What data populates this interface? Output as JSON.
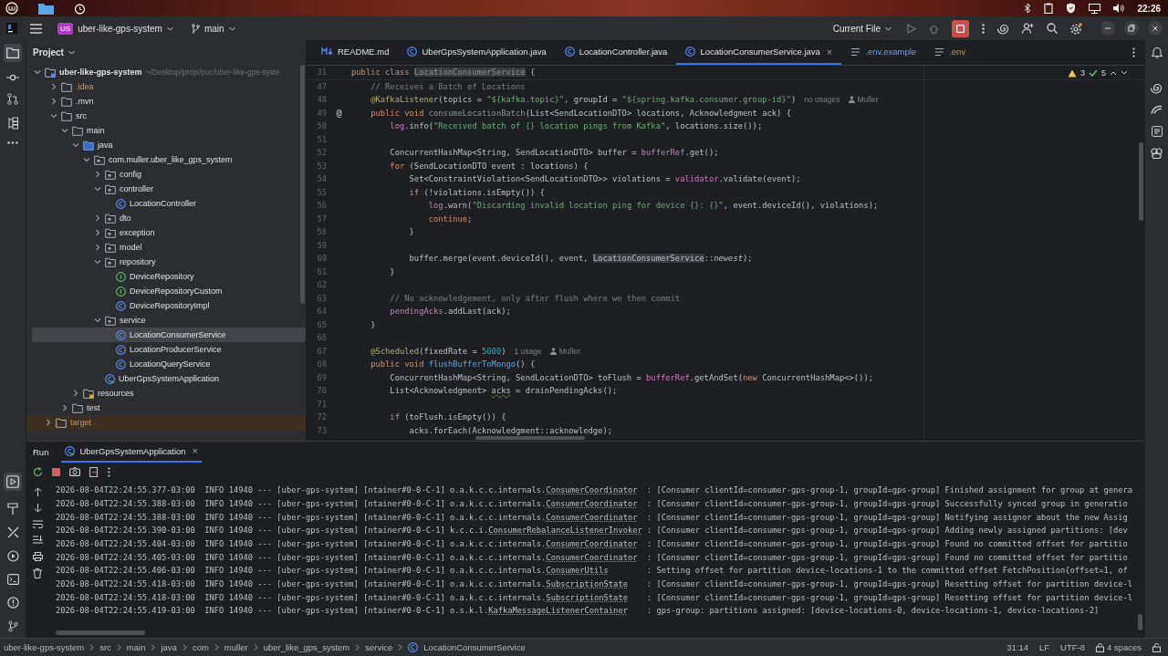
{
  "desktop_panel": {
    "clock": "22:26"
  },
  "title_bar": {
    "project_badge": "US",
    "project": "uber-like-gps-system",
    "branch": "main",
    "run_config": "Current File",
    "running": true
  },
  "project_panel": {
    "title": "Project",
    "tree": [
      {
        "label": "uber-like-gps-system",
        "path": "~/Desktop/projs/puc/uber-like-gps-syste",
        "kind": "module",
        "expanded": true,
        "selected": false,
        "children": [
          {
            "label": ".idea",
            "kind": "ignored",
            "expanded": false,
            "selected": false
          },
          {
            "label": ".mvn",
            "kind": "folder",
            "expanded": false,
            "selected": false
          },
          {
            "label": "src",
            "kind": "folder",
            "expanded": true,
            "selected": false,
            "children": [
              {
                "label": "main",
                "kind": "folder",
                "expanded": true,
                "selected": false,
                "children": [
                  {
                    "label": "java",
                    "kind": "source",
                    "expanded": true,
                    "selected": false,
                    "children": [
                      {
                        "label": "com.muller.uber_like_gps_system",
                        "kind": "package",
                        "expanded": true,
                        "selected": false,
                        "children": [
                          {
                            "label": "config",
                            "kind": "package",
                            "expanded": false,
                            "selected": false
                          },
                          {
                            "label": "controller",
                            "kind": "package",
                            "expanded": true,
                            "selected": false,
                            "children": [
                              {
                                "label": "LocationController",
                                "kind": "class",
                                "selected": false
                              }
                            ]
                          },
                          {
                            "label": "dto",
                            "kind": "package",
                            "expanded": false,
                            "selected": false
                          },
                          {
                            "label": "exception",
                            "kind": "package",
                            "expanded": false,
                            "selected": false
                          },
                          {
                            "label": "model",
                            "kind": "package",
                            "expanded": false,
                            "selected": false
                          },
                          {
                            "label": "repository",
                            "kind": "package",
                            "expanded": true,
                            "selected": false,
                            "children": [
                              {
                                "label": "DeviceRepository",
                                "kind": "interface",
                                "selected": false
                              },
                              {
                                "label": "DeviceRepositoryCustom",
                                "kind": "interface",
                                "selected": false
                              },
                              {
                                "label": "DeviceRepositoryImpl",
                                "kind": "class",
                                "selected": false
                              }
                            ]
                          },
                          {
                            "label": "service",
                            "kind": "package",
                            "expanded": true,
                            "selected": false,
                            "children": [
                              {
                                "label": "LocationConsumerService",
                                "kind": "class",
                                "selected": true
                              },
                              {
                                "label": "LocationProducerService",
                                "kind": "class",
                                "selected": false
                              },
                              {
                                "label": "LocationQueryService",
                                "kind": "class",
                                "selected": false
                              }
                            ]
                          },
                          {
                            "label": "UberGpsSystemApplication",
                            "kind": "app",
                            "selected": false
                          }
                        ]
                      }
                    ]
                  },
                  {
                    "label": "resources",
                    "kind": "resources",
                    "expanded": false,
                    "selected": false
                  }
                ]
              },
              {
                "label": "test",
                "kind": "folder",
                "expanded": false,
                "selected": false
              }
            ]
          },
          {
            "label": "target",
            "kind": "excluded",
            "expanded": false,
            "selected": false
          }
        ]
      }
    ]
  },
  "editor_tabs": [
    {
      "label": "README.md",
      "kind": "markdown",
      "modified": false,
      "ignored": false,
      "selected": false
    },
    {
      "label": "UberGpsSystemApplication.java",
      "kind": "class",
      "modified": false,
      "ignored": false,
      "selected": false
    },
    {
      "label": "LocationController.java",
      "kind": "class",
      "modified": false,
      "ignored": false,
      "selected": false
    },
    {
      "label": "LocationConsumerService.java",
      "kind": "class",
      "modified": false,
      "ignored": false,
      "selected": true,
      "close": "×"
    },
    {
      "label": ".env.example",
      "kind": "text",
      "modified": true,
      "ignored": false,
      "selected": false
    },
    {
      "label": ".env",
      "kind": "text",
      "modified": false,
      "ignored": true,
      "selected": false
    }
  ],
  "inspections": {
    "warnings": "3",
    "weak_warnings": "5"
  },
  "code_lines": [
    {
      "no": "31",
      "tokens": [
        {
          "text": "public class ",
          "kind": "kw"
        },
        {
          "text": "LocationConsumerService",
          "kind": "decl"
        },
        {
          "text": " {",
          "kind": "plain"
        }
      ]
    },
    {
      "no": "47",
      "tokens": [
        {
          "text": "    // Receives a Batch of Locations",
          "kind": "comment"
        }
      ]
    },
    {
      "no": "48",
      "tokens": [
        {
          "text": "    @KafkaListener",
          "kind": "ann"
        },
        {
          "text": "(topics = ",
          "kind": "plain"
        },
        {
          "text": "\"${kafka.topic}\"",
          "kind": "str"
        },
        {
          "text": ", groupId = ",
          "kind": "plain"
        },
        {
          "text": "\"${spring.kafka.consumer.group-id}\"",
          "kind": "str"
        },
        {
          "text": ")",
          "kind": "plain"
        }
      ],
      "hints": [
        {
          "text": "no usages",
          "kind": "usages"
        },
        {
          "text": "Muller",
          "kind": "author"
        }
      ]
    },
    {
      "no": "49",
      "gutter": "@",
      "tokens": [
        {
          "text": "    public void ",
          "kind": "kw"
        },
        {
          "text": "consumeLocationBatch",
          "kind": "unused"
        },
        {
          "text": "(List<SendLocationDTO> locations, Acknowledgment ack) {",
          "kind": "plain"
        }
      ]
    },
    {
      "no": "50",
      "tokens": [
        {
          "text": "        log",
          "kind": "field"
        },
        {
          "text": ".info(",
          "kind": "plain"
        },
        {
          "text": "\"Received batch of {} location pings from Kafka\"",
          "kind": "str"
        },
        {
          "text": ", locations.size());",
          "kind": "plain"
        }
      ]
    },
    {
      "no": "51"
    },
    {
      "no": "52",
      "tokens": [
        {
          "text": "        ConcurrentHashMap<String, SendLocationDTO> buffer = ",
          "kind": "plain"
        },
        {
          "text": "bufferRef",
          "kind": "field"
        },
        {
          "text": ".get();",
          "kind": "plain"
        }
      ]
    },
    {
      "no": "53",
      "tokens": [
        {
          "text": "        for ",
          "kind": "kw"
        },
        {
          "text": "(SendLocationDTO event : locations) {",
          "kind": "plain"
        }
      ]
    },
    {
      "no": "54",
      "tokens": [
        {
          "text": "            Set<ConstraintViolation<SendLocationDTO>> violations = ",
          "kind": "plain"
        },
        {
          "text": "validator",
          "kind": "field"
        },
        {
          "text": ".validate(event);",
          "kind": "plain"
        }
      ]
    },
    {
      "no": "55",
      "tokens": [
        {
          "text": "            if ",
          "kind": "kw"
        },
        {
          "text": "(!violations.isEmpty()) {",
          "kind": "plain"
        }
      ]
    },
    {
      "no": "56",
      "tokens": [
        {
          "text": "                log",
          "kind": "field"
        },
        {
          "text": ".warn(",
          "kind": "plain"
        },
        {
          "text": "\"Discarding invalid location ping for device {}: {}\"",
          "kind": "str"
        },
        {
          "text": ", event.deviceId(), violations);",
          "kind": "plain"
        }
      ]
    },
    {
      "no": "57",
      "tokens": [
        {
          "text": "                continue",
          "kind": "kw"
        },
        {
          "text": ";",
          "kind": "plain"
        }
      ]
    },
    {
      "no": "58",
      "tokens": [
        {
          "text": "            }",
          "kind": "plain"
        }
      ]
    },
    {
      "no": "59"
    },
    {
      "no": "60",
      "tokens": [
        {
          "text": "            buffer.merge(event.deviceId(), event, ",
          "kind": "plain"
        },
        {
          "text": "LocationConsumerService",
          "kind": "ref"
        },
        {
          "text": "::",
          "kind": "plain"
        },
        {
          "text": "newest",
          "kind": "static"
        },
        {
          "text": ");",
          "kind": "plain"
        }
      ]
    },
    {
      "no": "61",
      "tokens": [
        {
          "text": "        }",
          "kind": "plain"
        }
      ]
    },
    {
      "no": "62"
    },
    {
      "no": "63",
      "tokens": [
        {
          "text": "        // No acknowledgement, only after flush where we then commit",
          "kind": "comment"
        }
      ]
    },
    {
      "no": "64",
      "tokens": [
        {
          "text": "        pendingAcks",
          "kind": "field"
        },
        {
          "text": ".addLast(ack);",
          "kind": "plain"
        }
      ]
    },
    {
      "no": "65",
      "tokens": [
        {
          "text": "    }",
          "kind": "plain"
        }
      ]
    },
    {
      "no": "66"
    },
    {
      "no": "67",
      "tokens": [
        {
          "text": "    @Scheduled",
          "kind": "ann"
        },
        {
          "text": "(fixedRate = ",
          "kind": "plain"
        },
        {
          "text": "5000",
          "kind": "num"
        },
        {
          "text": ")",
          "kind": "plain"
        }
      ],
      "hints": [
        {
          "text": "1 usage",
          "kind": "usages"
        },
        {
          "text": "Muller",
          "kind": "author"
        }
      ]
    },
    {
      "no": "68",
      "tokens": [
        {
          "text": "    public void ",
          "kind": "kw"
        },
        {
          "text": "flushBufferToMongo",
          "kind": "method"
        },
        {
          "text": "() {",
          "kind": "plain"
        }
      ]
    },
    {
      "no": "69",
      "tokens": [
        {
          "text": "        ConcurrentHashMap<String, SendLocationDTO> toFlush = ",
          "kind": "plain"
        },
        {
          "text": "bufferRef",
          "kind": "field"
        },
        {
          "text": ".getAndSet(",
          "kind": "plain"
        },
        {
          "text": "new ",
          "kind": "kw"
        },
        {
          "text": "ConcurrentHashMap<>());",
          "kind": "plain"
        }
      ]
    },
    {
      "no": "70",
      "tokens": [
        {
          "text": "        List<Acknowledgment> ",
          "kind": "plain"
        },
        {
          "text": "acks",
          "kind": "warn"
        },
        {
          "text": " = drainPendingAcks();",
          "kind": "plain"
        }
      ]
    },
    {
      "no": "71"
    },
    {
      "no": "72",
      "tokens": [
        {
          "text": "        if ",
          "kind": "kw"
        },
        {
          "text": "(toFlush.isEmpty()) {",
          "kind": "plain"
        }
      ]
    },
    {
      "no": "73",
      "tokens": [
        {
          "text": "            acks.forEach(Acknowledgment::acknowledge);",
          "kind": "plain"
        }
      ]
    }
  ],
  "run_panel": {
    "title": "Run",
    "tabs": [
      {
        "label": "UberGpsSystemApplication",
        "selected": true,
        "close": "×"
      }
    ],
    "log": [
      {
        "timestamp": "2026-08-04T22:24:55.377-03:00",
        "level": "INFO",
        "pid": "14940",
        "separator": "---",
        "app": "[uber-gps-system]",
        "thread": "[ntainer#0-0-C-1]",
        "logger_package": "o.a.k.c.c.internals.",
        "logger_class": "ConsumerCoordinator",
        "message": ": [Consumer clientId=consumer-gps-group-1, groupId=gps-group] Finished assignment for group at genera"
      },
      {
        "timestamp": "2026-08-04T22:24:55.388-03:00",
        "level": "INFO",
        "pid": "14940",
        "separator": "---",
        "app": "[uber-gps-system]",
        "thread": "[ntainer#0-0-C-1]",
        "logger_package": "o.a.k.c.c.internals.",
        "logger_class": "ConsumerCoordinator",
        "message": ": [Consumer clientId=consumer-gps-group-1, groupId=gps-group] Successfully synced group in generatio"
      },
      {
        "timestamp": "2026-08-04T22:24:55.388-03:00",
        "level": "INFO",
        "pid": "14940",
        "separator": "---",
        "app": "[uber-gps-system]",
        "thread": "[ntainer#0-0-C-1]",
        "logger_package": "o.a.k.c.c.internals.",
        "logger_class": "ConsumerCoordinator",
        "message": ": [Consumer clientId=consumer-gps-group-1, groupId=gps-group] Notifying assignor about the new Assig"
      },
      {
        "timestamp": "2026-08-04T22:24:55.390-03:00",
        "level": "INFO",
        "pid": "14940",
        "separator": "---",
        "app": "[uber-gps-system]",
        "thread": "[ntainer#0-0-C-1]",
        "logger_package": "k.c.c.i.",
        "logger_class": "ConsumerRebalanceListenerInvoker",
        "message": ": [Consumer clientId=consumer-gps-group-1, groupId=gps-group] Adding newly assigned partitions: [dev"
      },
      {
        "timestamp": "2026-08-04T22:24:55.404-03:00",
        "level": "INFO",
        "pid": "14940",
        "separator": "---",
        "app": "[uber-gps-system]",
        "thread": "[ntainer#0-0-C-1]",
        "logger_package": "o.a.k.c.c.internals.",
        "logger_class": "ConsumerCoordinator",
        "message": ": [Consumer clientId=consumer-gps-group-1, groupId=gps-group] Found no committed offset for partitio"
      },
      {
        "timestamp": "2026-08-04T22:24:55.405-03:00",
        "level": "INFO",
        "pid": "14940",
        "separator": "---",
        "app": "[uber-gps-system]",
        "thread": "[ntainer#0-0-C-1]",
        "logger_package": "o.a.k.c.c.internals.",
        "logger_class": "ConsumerCoordinator",
        "message": ": [Consumer clientId=consumer-gps-group-1, groupId=gps-group] Found no committed offset for partitio"
      },
      {
        "timestamp": "2026-08-04T22:24:55.406-03:00",
        "level": "INFO",
        "pid": "14940",
        "separator": "---",
        "app": "[uber-gps-system]",
        "thread": "[ntainer#0-0-C-1]",
        "logger_package": "o.a.k.c.c.internals.",
        "logger_class": "ConsumerUtils",
        "message": ": Setting offset for partition device-locations-1 to the committed offset FetchPosition{offset=1, of"
      },
      {
        "timestamp": "2026-08-04T22:24:55.418-03:00",
        "level": "INFO",
        "pid": "14940",
        "separator": "---",
        "app": "[uber-gps-system]",
        "thread": "[ntainer#0-0-C-1]",
        "logger_package": "o.a.k.c.c.internals.",
        "logger_class": "SubscriptionState",
        "message": ": [Consumer clientId=consumer-gps-group-1, groupId=gps-group] Resetting offset for partition device-l"
      },
      {
        "timestamp": "2026-08-04T22:24:55.418-03:00",
        "level": "INFO",
        "pid": "14940",
        "separator": "---",
        "app": "[uber-gps-system]",
        "thread": "[ntainer#0-0-C-1]",
        "logger_package": "o.a.k.c.c.internals.",
        "logger_class": "SubscriptionState",
        "message": ": [Consumer clientId=consumer-gps-group-1, groupId=gps-group] Resetting offset for partition device-l"
      },
      {
        "timestamp": "2026-08-04T22:24:55.419-03:00",
        "level": "INFO",
        "pid": "14940",
        "separator": "---",
        "app": "[uber-gps-system]",
        "thread": "[ntainer#0-0-C-1]",
        "logger_package": "o.s.k.l.",
        "logger_class": "KafkaMessageListenerContainer",
        "message": ": gps-group: partitions assigned: [device-locations-0, device-locations-1, device-locations-2]"
      }
    ]
  },
  "status_bar": {
    "breadcrumb": [
      "uber-like-gps-system",
      "src",
      "main",
      "java",
      "com",
      "muller",
      "uber_like_gps_system",
      "service",
      "LocationConsumerService"
    ],
    "caret": "31:14",
    "line_ending": "LF",
    "encoding": "UTF-8",
    "indent": "4 spaces"
  }
}
